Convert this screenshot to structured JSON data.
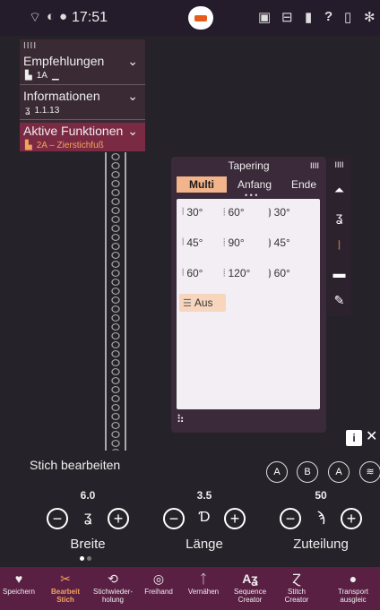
{
  "status": {
    "time": "17:51",
    "wifi_icon": "wifi-icon",
    "mute_icon": "muted-icon"
  },
  "panel": {
    "empfehlungen": "Empfehlungen",
    "empf_value": "1A",
    "informationen": "Informationen",
    "info_value": "1.1.13",
    "aktive": "Aktive Funktionen",
    "aktive_value": "2A – Zierstichfuß"
  },
  "tapering": {
    "title": "Tapering",
    "tabs": [
      "Multi",
      "Anfang",
      "Ende"
    ],
    "options": [
      "30°",
      "60°",
      "30°",
      "45°",
      "90°",
      "45°",
      "60°",
      "120°",
      "60°"
    ],
    "aus": "Aus"
  },
  "edit": {
    "title": "Stich bearbeiten",
    "breite_value": "6.0",
    "laenge_value": "3.5",
    "zuteilung_value": "50",
    "breite": "Breite",
    "laenge": "Länge",
    "zuteilung": "Zuteilung",
    "minus": "−",
    "plus": "+"
  },
  "nav": [
    {
      "l1": "Speichern",
      "l2": ""
    },
    {
      "l1": "Bearbeit",
      "l2": "Stich"
    },
    {
      "l1": "Stichwieder-",
      "l2": "holung"
    },
    {
      "l1": "Freihand",
      "l2": ""
    },
    {
      "l1": "Vernähen",
      "l2": ""
    },
    {
      "l1": "Sequence",
      "l2": "Creator"
    },
    {
      "l1": "Stitch",
      "l2": "Creator"
    },
    {
      "l1": "Transport",
      "l2": "ausgleic"
    }
  ],
  "colors": {
    "accent": "#f2a35c",
    "tab_active": "#f2b48a",
    "nav_bg": "#5a2044"
  }
}
